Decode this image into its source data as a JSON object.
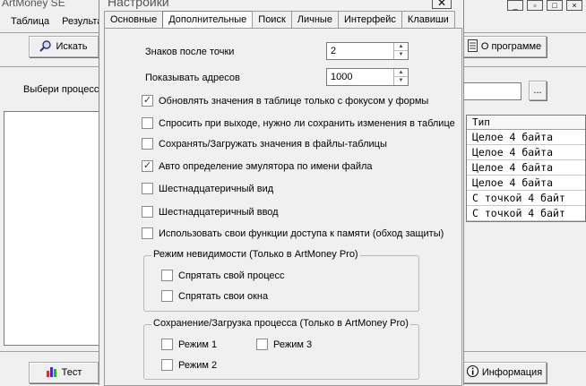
{
  "main_window": {
    "title": "ArtMoney SE",
    "menu": [
      "Таблица",
      "Результа"
    ],
    "search_button": "Искать",
    "process_label": "Выбери процесс",
    "browse_button": "...",
    "about_button": "О программе",
    "test_button": "Тест",
    "info_button": "Информация",
    "table": {
      "header": "Тип",
      "rows": [
        "Целое 4 байта",
        "Целое 4 байта",
        "Целое 4 байта",
        "Целое 4 байта",
        "С точкой 4 байт",
        "С точкой 4 байт"
      ]
    }
  },
  "dialog": {
    "title": "Настройки",
    "close": "✕",
    "tabs": [
      "Основные",
      "Дополнительные",
      "Поиск",
      "Личные",
      "Интерфейс",
      "Клавиши"
    ],
    "active_tab": "Дополнительные",
    "decimals_label": "Знаков после точки",
    "decimals_value": "2",
    "addresses_label": "Показывать адресов",
    "addresses_value": "1000",
    "options": [
      {
        "label": "Обновлять значения в таблице только с фокусом у формы",
        "checked": true
      },
      {
        "label": "Спросить при выходе, нужно ли сохранить изменения в таблице",
        "checked": false
      },
      {
        "label": "Сохранять/Загружать значения в файлы-таблицы",
        "checked": false
      },
      {
        "label": "Авто определение эмулятора по имени файла",
        "checked": true
      },
      {
        "label": "Шестнадцатеричный вид",
        "checked": false
      },
      {
        "label": "Шестнадцатеричный ввод",
        "checked": false
      },
      {
        "label": "Использовать свои функции доступа к памяти (обход защиты)",
        "checked": false
      }
    ],
    "stealth_group": {
      "title": "Режим невидимости (Только в ArtMoney Pro)",
      "options": [
        {
          "label": "Спрятать свой процесс",
          "checked": false
        },
        {
          "label": "Спрятать свои окна",
          "checked": false
        }
      ]
    },
    "save_group": {
      "title": "Сохранение/Загрузка процесса (Только в ArtMoney Pro)",
      "options": [
        {
          "label": "Режим 1",
          "checked": false
        },
        {
          "label": "Режим 3",
          "checked": false
        },
        {
          "label": "Режим 2",
          "checked": false
        }
      ]
    }
  }
}
